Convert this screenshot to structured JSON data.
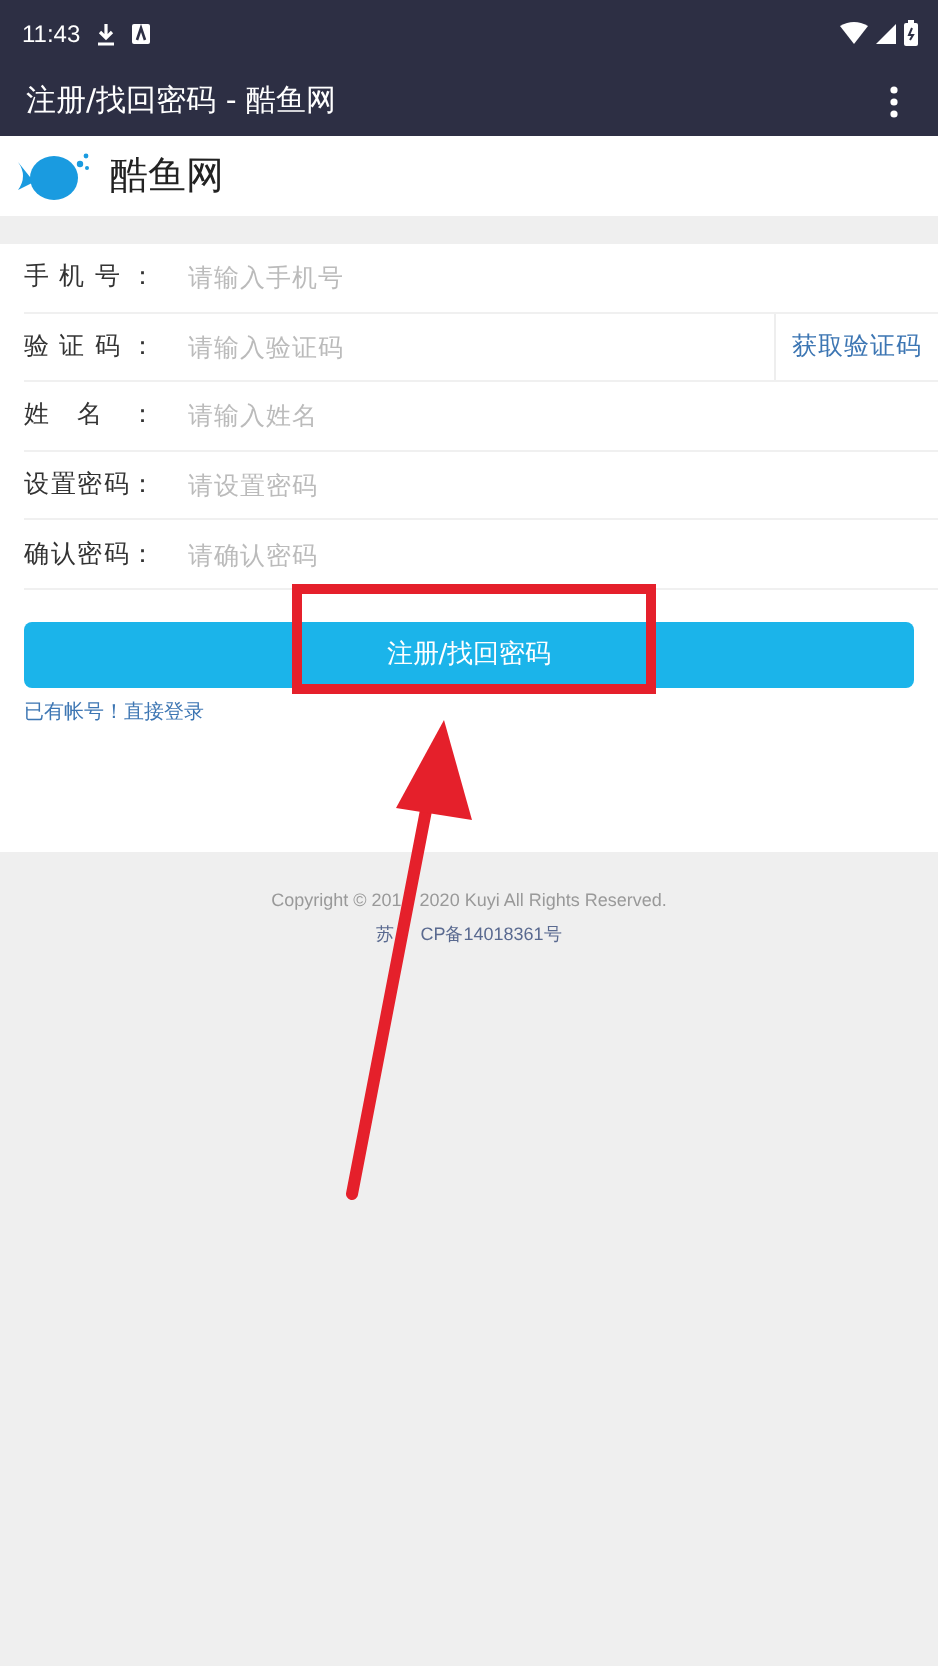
{
  "status_bar": {
    "time": "11:43"
  },
  "app_bar": {
    "title": "注册/找回密码 - 酷鱼网"
  },
  "site": {
    "name": "酷鱼网"
  },
  "form": {
    "fields": [
      {
        "label": "手机号：",
        "placeholder": "请输入手机号"
      },
      {
        "label": "验证码：",
        "placeholder": "请输入验证码",
        "action": "获取验证码"
      },
      {
        "label": "姓名：",
        "placeholder": "请输入姓名"
      },
      {
        "label": "设置密码：",
        "placeholder": "请设置密码"
      },
      {
        "label": "确认密码：",
        "placeholder": "请确认密码"
      }
    ],
    "submit": "注册/找回密码",
    "login_link": "已有帐号！直接登录"
  },
  "footer": {
    "copyright": [
      "Copyright © 201",
      "2020 Kuyi All Rights Reserved."
    ],
    "icp": [
      "苏",
      "CP备14018361号"
    ]
  },
  "annotations": {
    "frame": true,
    "arrow": true
  }
}
